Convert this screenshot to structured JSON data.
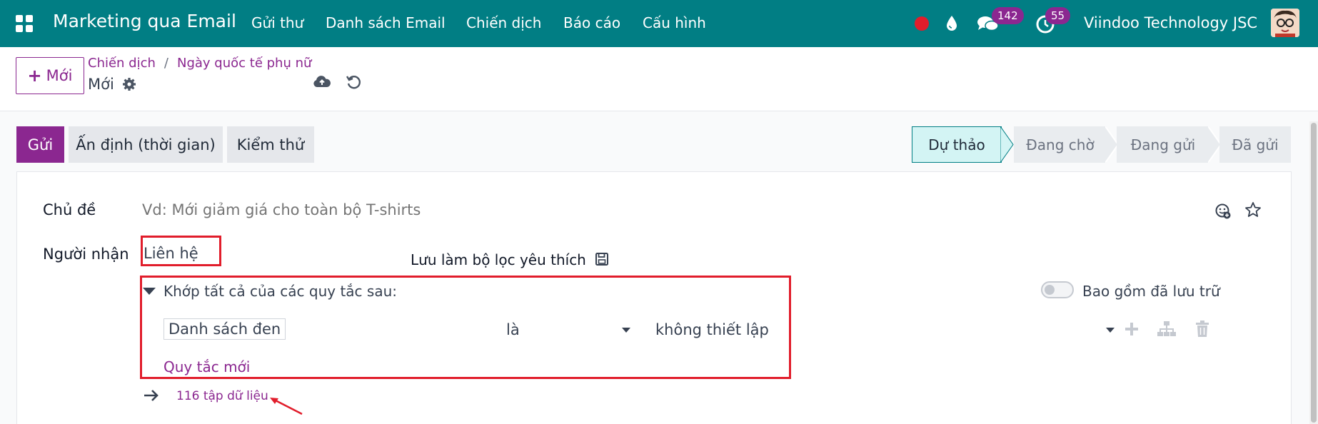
{
  "navbar": {
    "app_title": "Marketing qua Email",
    "menu": [
      "Gửi thư",
      "Danh sách Email",
      "Chiến dịch",
      "Báo cáo",
      "Cấu hình"
    ],
    "chat_count": "142",
    "activity_count": "55",
    "company": "Viindoo Technology JSC"
  },
  "control": {
    "new_label": "Mới",
    "breadcrumb": [
      "Chiến dịch",
      "Ngày quốc tế phụ nữ"
    ],
    "record_name": "Mới"
  },
  "actions": {
    "send": "Gửi",
    "schedule": "Ấn định (thời gian)",
    "test": "Kiểm thử"
  },
  "statusbar": [
    "Dự thảo",
    "Đang chờ",
    "Đang gửi",
    "Đã gửi"
  ],
  "form": {
    "subject_label": "Chủ đề",
    "subject_placeholder": "Vd: Mới giảm giá cho toàn bộ T-shirts",
    "recipients_label": "Người nhận",
    "recipients_value": "Liên hệ",
    "save_filter": "Lưu làm bộ lọc yêu thích",
    "match_text": "Khớp tất cả của các quy tắc sau:",
    "include_archived": "Bao gồm đã lưu trữ",
    "rule": {
      "field": "Danh sách đen",
      "operator": "là",
      "value": "không thiết lập"
    },
    "new_rule": "Quy tắc mới",
    "records_count": "116 tập dữ liệu"
  },
  "colors": {
    "navbar": "#017e84",
    "primary": "#8b2790",
    "highlight": "#e11d2b"
  }
}
